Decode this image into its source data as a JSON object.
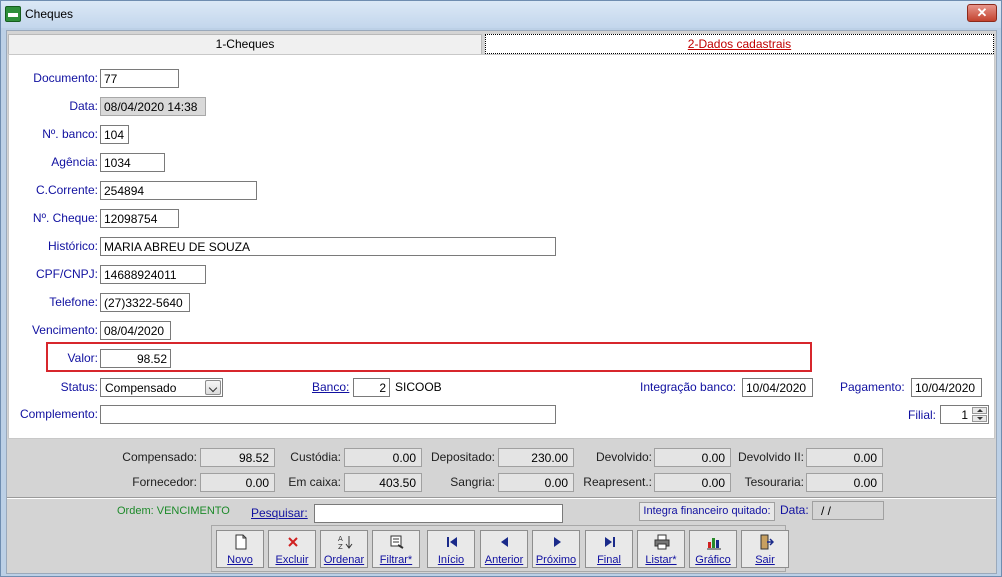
{
  "window": {
    "title": "Cheques"
  },
  "tabs": [
    {
      "label": "1-Cheques"
    },
    {
      "label": "2-Dados cadastrais"
    }
  ],
  "form": {
    "documento": {
      "label": "Documento:",
      "value": "77"
    },
    "data": {
      "label": "Data:",
      "value": "08/04/2020 14:38"
    },
    "nbanco": {
      "label": "Nº. banco:",
      "value": "104"
    },
    "agencia": {
      "label": "Agência:",
      "value": "1034"
    },
    "ccorrente": {
      "label": "C.Corrente:",
      "value": "254894"
    },
    "ncheque": {
      "label": "Nº. Cheque:",
      "value": "12098754"
    },
    "historico": {
      "label": "Histórico:",
      "value": "MARIA ABREU DE SOUZA"
    },
    "cpfcnpj": {
      "label": "CPF/CNPJ:",
      "value": "14688924011"
    },
    "telefone": {
      "label": "Telefone:",
      "value": "(27)3322-5640"
    },
    "vencimento": {
      "label": "Vencimento:",
      "value": "08/04/2020"
    },
    "valor": {
      "label": "Valor:",
      "value": "98.52"
    },
    "status": {
      "label": "Status:",
      "value": "Compensado"
    },
    "banco": {
      "label": "Banco:",
      "code": "2",
      "name": "SICOOB"
    },
    "integracao": {
      "label": "Integração banco:",
      "value": "10/04/2020"
    },
    "pagamento": {
      "label": "Pagamento:",
      "value": "10/04/2020"
    },
    "complemento": {
      "label": "Complemento:",
      "value": ""
    },
    "filial": {
      "label": "Filial:",
      "value": "1"
    }
  },
  "summary": {
    "compensado": {
      "label": "Compensado:",
      "value": "98.52"
    },
    "custodia": {
      "label": "Custódia:",
      "value": "0.00"
    },
    "depositado": {
      "label": "Depositado:",
      "value": "230.00"
    },
    "devolvido": {
      "label": "Devolvido:",
      "value": "0.00"
    },
    "devolvido2": {
      "label": "Devolvido II:",
      "value": "0.00"
    },
    "fornecedor": {
      "label": "Fornecedor:",
      "value": "0.00"
    },
    "emcaixa": {
      "label": "Em caixa:",
      "value": "403.50"
    },
    "sangria": {
      "label": "Sangria:",
      "value": "0.00"
    },
    "reapresent": {
      "label": "Reapresent.:",
      "value": "0.00"
    },
    "tesouraria": {
      "label": "Tesouraria:",
      "value": "0.00"
    }
  },
  "footer": {
    "order": "Ordem: VENCIMENTO",
    "search_label": "Pesquisar:",
    "integra": "Integra financeiro quitado:",
    "data_label": "Data:",
    "data_value": " /  /"
  },
  "toolbar": {
    "novo": "Novo",
    "excluir": "Excluir",
    "ordenar": "Ordenar",
    "filtrar": "Filtrar*",
    "inicio": "Início",
    "anterior": "Anterior",
    "proximo": "Próximo",
    "final": "Final",
    "listar": "Listar*",
    "grafico": "Gráfico",
    "sair": "Sair"
  }
}
